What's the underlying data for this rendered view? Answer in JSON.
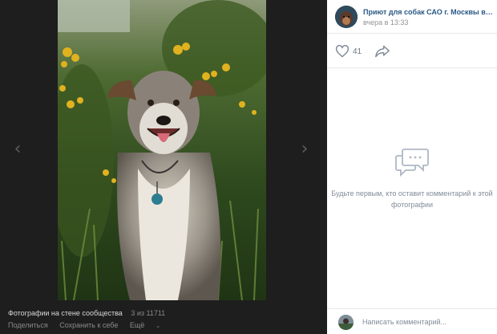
{
  "photo": {
    "nav_prev_icon": "chevron-left-icon",
    "nav_next_icon": "chevron-right-icon"
  },
  "footer": {
    "album_title": "Фотографии на стене сообщества",
    "counter": "3 из 11711",
    "share_label": "Поделиться",
    "save_label": "Сохранить к себе",
    "more_label": "Ещё"
  },
  "post": {
    "author": "Приют для собак САО г. Москвы в ...",
    "date": "вчера в 13:33",
    "likes": "41",
    "like_icon": "heart-icon",
    "share_icon": "share-arrow-icon"
  },
  "comments": {
    "empty_icon": "comment-bubbles-icon",
    "empty_text": "Будьте первым, кто оставит комментарий к этой фотографии",
    "placeholder": "Написать комментарий..."
  },
  "colors": {
    "link": "#2a5885",
    "muted": "#818c99",
    "dark_bg": "#1e1e1e"
  }
}
